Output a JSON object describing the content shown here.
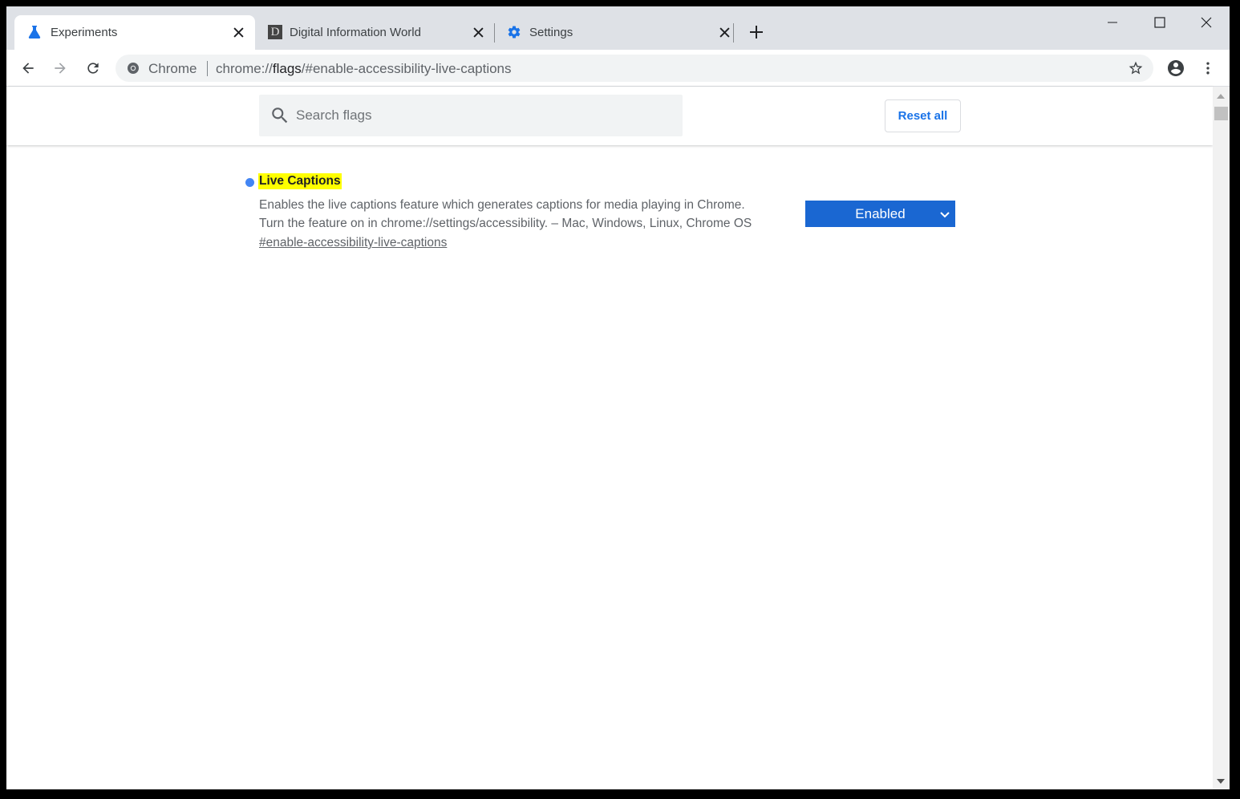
{
  "tabs": [
    {
      "title": "Experiments",
      "icon": "flask-icon",
      "active": true
    },
    {
      "title": "Digital Information World",
      "icon": "site-favicon-d",
      "favicon_letter": "D",
      "active": false
    },
    {
      "title": "Settings",
      "icon": "gear-icon",
      "active": false
    }
  ],
  "omnibox": {
    "chip": "Chrome",
    "url_prefix": "chrome://",
    "url_host": "flags",
    "url_rest": "/#enable-accessibility-live-captions"
  },
  "header": {
    "search_placeholder": "Search flags",
    "reset_label": "Reset all"
  },
  "experiment": {
    "title": "Live Captions",
    "description_line1": "Enables the live captions feature which generates captions for media playing in Chrome.",
    "description_line2": "Turn the feature on in chrome://settings/accessibility. – Mac, Windows, Linux, Chrome OS",
    "link": "#enable-accessibility-live-captions",
    "state": "Enabled"
  },
  "colors": {
    "accent": "#1a73e8",
    "select_bg": "#1a67d2",
    "highlight": "#ffff00",
    "tabstrip": "#dee1e6"
  }
}
